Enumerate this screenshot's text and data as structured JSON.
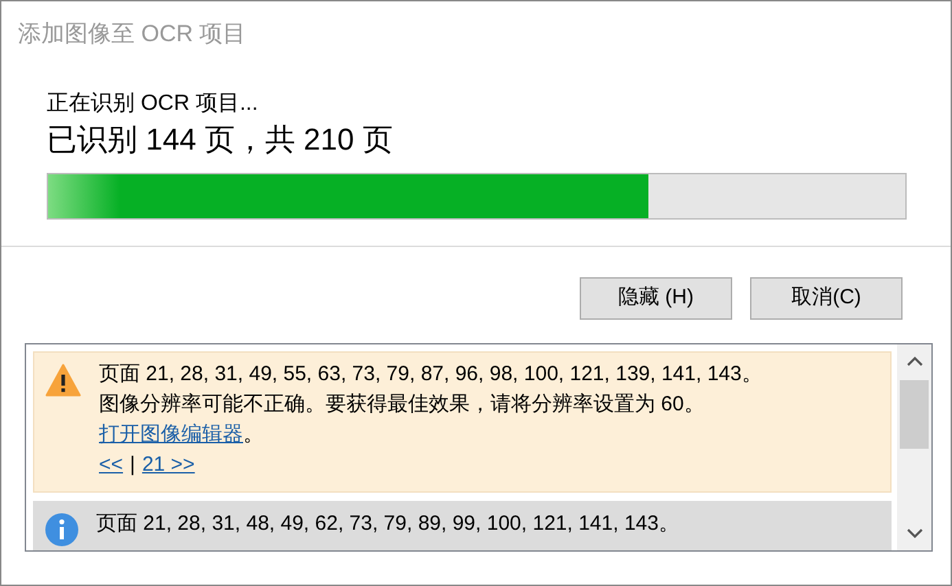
{
  "window": {
    "title": "添加图像至 OCR 项目"
  },
  "progress": {
    "status": "正在识别 OCR 项目...",
    "count": "已识别 144 页，共 210 页",
    "level": 0.7
  },
  "buttons": [
    {
      "label": "隐藏 (H)"
    },
    {
      "label": "取消(C)"
    }
  ],
  "messages": [
    {
      "kind": "warning",
      "pages": "页面 21, 28, 31, 49, 55, 63, 73, 79, 87, 96, 98, 100, 121, 139, 141, 143。",
      "detail": "图像分辨率可能不正确。要获得最佳效果，请将分辨率设置为 60。",
      "link": "打开图像编辑器",
      "link_suffix": "。",
      "nav_prev": "<<",
      "nav_sep": "|",
      "nav_next": "21 >>"
    },
    {
      "kind": "info",
      "pages": "页面 21, 28, 31, 48, 49, 62, 73, 79, 89, 99, 100, 121, 141, 143。"
    }
  ]
}
